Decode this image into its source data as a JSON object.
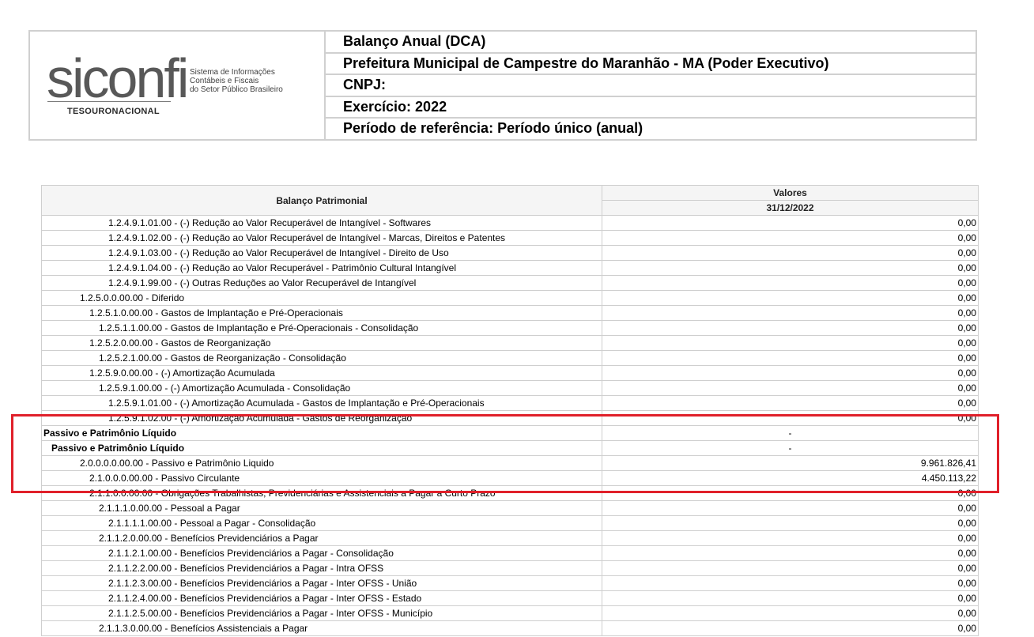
{
  "logo": {
    "word": "siconfi",
    "subtitle": "Sistema de Informações\nContábeis e Fiscais\ndo Setor Público Brasileiro",
    "org": "TESOURONACIONAL"
  },
  "header": {
    "report": "Balanço Anual (DCA)",
    "entity": "Prefeitura Municipal de Campestre do Maranhão - MA (Poder Executivo)",
    "cnpj": "CNPJ:",
    "exercise": "Exercício: 2022",
    "period": "Período de referência: Período único (anual)"
  },
  "table": {
    "col_title": "Balanço Patrimonial",
    "col_values": "Valores",
    "col_date": "31/12/2022",
    "rows": [
      {
        "label": "1.2.4.9.1.01.00 - (-) Redução ao Valor Recuperável de Intangível - Softwares",
        "value": "0,00",
        "indent": 4
      },
      {
        "label": "1.2.4.9.1.02.00 - (-) Redução ao Valor Recuperável de Intangível - Marcas, Direitos e Patentes",
        "value": "0,00",
        "indent": 4
      },
      {
        "label": "1.2.4.9.1.03.00 - (-) Redução ao Valor Recuperável de Intangível - Direito de Uso",
        "value": "0,00",
        "indent": 4
      },
      {
        "label": "1.2.4.9.1.04.00 - (-) Redução ao Valor Recuperável - Patrimônio Cultural Intangível",
        "value": "0,00",
        "indent": 4
      },
      {
        "label": "1.2.4.9.1.99.00 - (-) Outras Reduções ao Valor Recuperável de Intangível",
        "value": "0,00",
        "indent": 4
      },
      {
        "label": "1.2.5.0.0.00.00 - Diferido",
        "value": "0,00",
        "indent": 1
      },
      {
        "label": "1.2.5.1.0.00.00 - Gastos de Implantação e Pré-Operacionais",
        "value": "0,00",
        "indent": 2
      },
      {
        "label": "1.2.5.1.1.00.00 - Gastos de Implantação e Pré-Operacionais - Consolidação",
        "value": "0,00",
        "indent": 3
      },
      {
        "label": "1.2.5.2.0.00.00 - Gastos de Reorganização",
        "value": "0,00",
        "indent": 2
      },
      {
        "label": "1.2.5.2.1.00.00 - Gastos de Reorganização - Consolidação",
        "value": "0,00",
        "indent": 3
      },
      {
        "label": "1.2.5.9.0.00.00 - (-) Amortização Acumulada",
        "value": "0,00",
        "indent": 2
      },
      {
        "label": "1.2.5.9.1.00.00 - (-) Amortização Acumulada - Consolidação",
        "value": "0,00",
        "indent": 3
      },
      {
        "label": "1.2.5.9.1.01.00 - (-) Amortização Acumulada - Gastos de Implantação e Pré-Operacionais",
        "value": "0,00",
        "indent": 4
      },
      {
        "label": "1.2.5.9.1.02.00 - (-) Amortização Acumulada - Gastos de Reorganização",
        "value": "0,00",
        "indent": 4
      },
      {
        "label": "Passivo e Patrimônio Líquido",
        "value": "-",
        "indent": 0,
        "bold": true,
        "dash": true
      },
      {
        "label": "Passivo e Patrimônio Líquido",
        "value": "-",
        "indent": 0.5,
        "bold": true,
        "dash": true
      },
      {
        "label": "2.0.0.0.0.00.00 - Passivo e Patrimônio Liquido",
        "value": "9.961.826,41",
        "indent": 1
      },
      {
        "label": "2.1.0.0.0.00.00 - Passivo Circulante",
        "value": "4.450.113,22",
        "indent": 2
      },
      {
        "label": "2.1.1.0.0.00.00 - Obrigações Trabalhistas, Previdenciárias e Assistenciais a Pagar a Curto Prazo",
        "value": "0,00",
        "indent": 2
      },
      {
        "label": "2.1.1.1.0.00.00 - Pessoal a Pagar",
        "value": "0,00",
        "indent": 3
      },
      {
        "label": "2.1.1.1.1.00.00 - Pessoal a Pagar - Consolidação",
        "value": "0,00",
        "indent": 4
      },
      {
        "label": "2.1.1.2.0.00.00 - Benefícios Previdenciários a Pagar",
        "value": "0,00",
        "indent": 3
      },
      {
        "label": "2.1.1.2.1.00.00 - Benefícios Previdenciários a Pagar - Consolidação",
        "value": "0,00",
        "indent": 4
      },
      {
        "label": "2.1.1.2.2.00.00 - Benefícios Previdenciários a Pagar - Intra OFSS",
        "value": "0,00",
        "indent": 4
      },
      {
        "label": "2.1.1.2.3.00.00 - Benefícios Previdenciários a Pagar - Inter OFSS - União",
        "value": "0,00",
        "indent": 4
      },
      {
        "label": "2.1.1.2.4.00.00 - Benefícios Previdenciários a Pagar - Inter OFSS - Estado",
        "value": "0,00",
        "indent": 4
      },
      {
        "label": "2.1.1.2.5.00.00 - Benefícios Previdenciários a Pagar - Inter OFSS - Município",
        "value": "0,00",
        "indent": 4
      },
      {
        "label": "2.1.1.3.0.00.00 - Benefícios Assistenciais a Pagar",
        "value": "0,00",
        "indent": 3
      }
    ]
  },
  "highlight_color": "#e0202a"
}
